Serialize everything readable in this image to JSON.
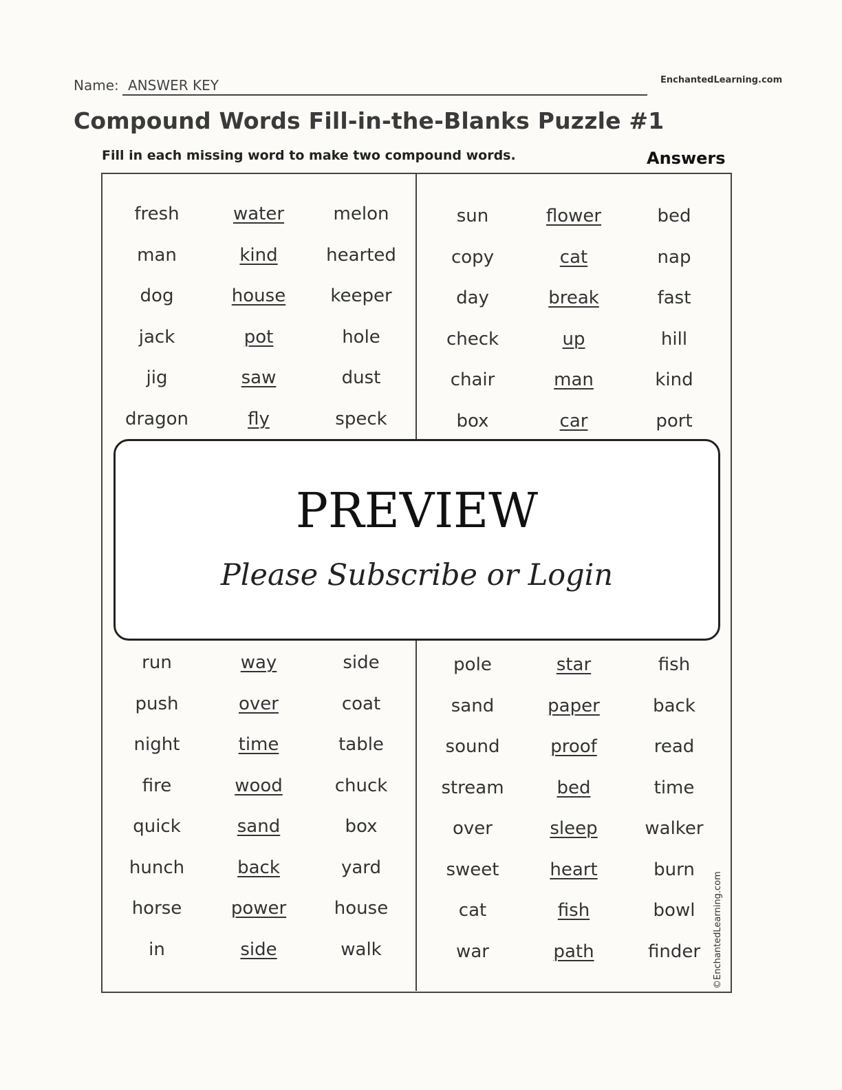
{
  "header": {
    "name_label": "Name:",
    "name_value": "ANSWER KEY",
    "site": "EnchantedLearning.com",
    "title": "Compound Words Fill-in-the-Blanks Puzzle #1",
    "instructions": "Fill in each missing word to make two compound words.",
    "answers_label": "Answers"
  },
  "puzzle": {
    "top_left": [
      [
        "fresh",
        "water",
        "melon"
      ],
      [
        "man",
        "kind",
        "hearted"
      ],
      [
        "dog",
        "house",
        "keeper"
      ],
      [
        "jack",
        "pot",
        "hole"
      ],
      [
        "jig",
        "saw",
        "dust"
      ],
      [
        "dragon",
        "fly",
        "speck"
      ]
    ],
    "top_right": [
      [
        "sun",
        "flower",
        "bed"
      ],
      [
        "copy",
        "cat",
        "nap"
      ],
      [
        "day",
        "break",
        "fast"
      ],
      [
        "check",
        "up",
        "hill"
      ],
      [
        "chair",
        "man",
        "kind"
      ],
      [
        "box",
        "car",
        "port"
      ]
    ],
    "bottom_left": [
      [
        "run",
        "way",
        "side"
      ],
      [
        "push",
        "over",
        "coat"
      ],
      [
        "night",
        "time",
        "table"
      ],
      [
        "fire",
        "wood",
        "chuck"
      ],
      [
        "quick",
        "sand",
        "box"
      ],
      [
        "hunch",
        "back",
        "yard"
      ],
      [
        "horse",
        "power",
        "house"
      ],
      [
        "in",
        "side",
        "walk"
      ]
    ],
    "bottom_right": [
      [
        "pole",
        "star",
        "fish"
      ],
      [
        "sand",
        "paper",
        "back"
      ],
      [
        "sound",
        "proof",
        "read"
      ],
      [
        "stream",
        "bed",
        "time"
      ],
      [
        "over",
        "sleep",
        "walker"
      ],
      [
        "sweet",
        "heart",
        "burn"
      ],
      [
        "cat",
        "fish",
        "bowl"
      ],
      [
        "war",
        "path",
        "finder"
      ]
    ]
  },
  "preview": {
    "title": "PREVIEW",
    "subtitle": "Please Subscribe or Login"
  },
  "copyright": "©EnchantedLearning.com"
}
